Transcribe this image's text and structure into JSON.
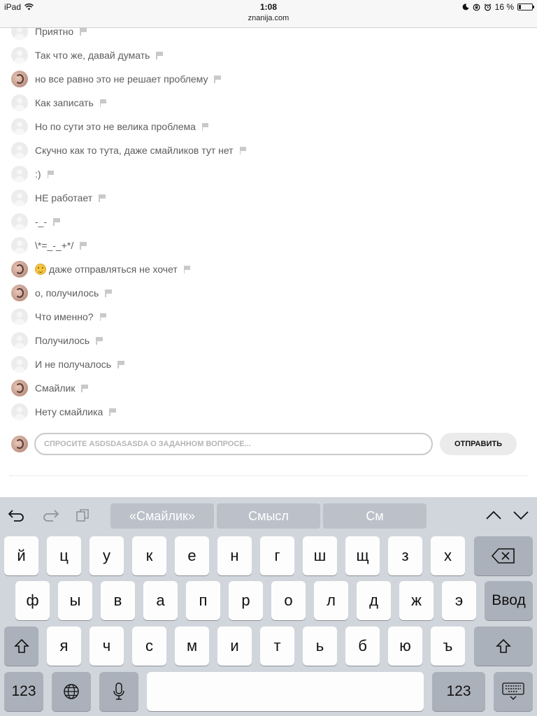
{
  "status_bar": {
    "device": "iPad",
    "time": "1:08",
    "url": "znanija.com",
    "battery": "16 %",
    "battery_fraction": 0.16
  },
  "messages": [
    {
      "avatar": "empty",
      "text": "Приятно"
    },
    {
      "avatar": "empty",
      "text": "Так что же, давай думать"
    },
    {
      "avatar": "user",
      "text": "но все равно это не решает проблему"
    },
    {
      "avatar": "empty",
      "text": "Как записать"
    },
    {
      "avatar": "empty",
      "text": "Но по сути это не велика проблема"
    },
    {
      "avatar": "empty",
      "text": "Скучно как то тута, даже смайликов тут нет"
    },
    {
      "avatar": "empty",
      "text": ":)"
    },
    {
      "avatar": "empty",
      "text": "НЕ работает"
    },
    {
      "avatar": "empty",
      "text": "-_-"
    },
    {
      "avatar": "empty",
      "text": "\\*=_-_+*/"
    },
    {
      "avatar": "user",
      "text": "даже отправляться не хочет",
      "emoji": true
    },
    {
      "avatar": "user",
      "text": "о, получилось"
    },
    {
      "avatar": "empty",
      "text": "Что именно?"
    },
    {
      "avatar": "empty",
      "text": "Получилось"
    },
    {
      "avatar": "empty",
      "text": "И не получалось"
    },
    {
      "avatar": "user",
      "text": "Смайлик"
    },
    {
      "avatar": "empty",
      "text": "Нету смайлика"
    }
  ],
  "composer": {
    "placeholder": "СПРОСИТЕ ASDSDASASDA О ЗАДАННОМ ВОПРОСЕ...",
    "send_label": "ОТПРАВИТЬ"
  },
  "keyboard": {
    "suggestions": [
      "«Смайлик»",
      "Смысл",
      "См"
    ],
    "row1": [
      "й",
      "ц",
      "у",
      "к",
      "е",
      "н",
      "г",
      "ш",
      "щ",
      "з",
      "х"
    ],
    "row2": [
      "ф",
      "ы",
      "в",
      "а",
      "п",
      "р",
      "о",
      "л",
      "д",
      "ж",
      "э"
    ],
    "row3": [
      "я",
      "ч",
      "с",
      "м",
      "и",
      "т",
      "ь",
      "б",
      "ю",
      "ъ"
    ],
    "return_label": "Ввод",
    "numbers_label": "123"
  },
  "colors": {
    "text": "#5d5d5d",
    "keyboard_bg": "#d1d5dc",
    "key_dark": "#abb1ba"
  }
}
